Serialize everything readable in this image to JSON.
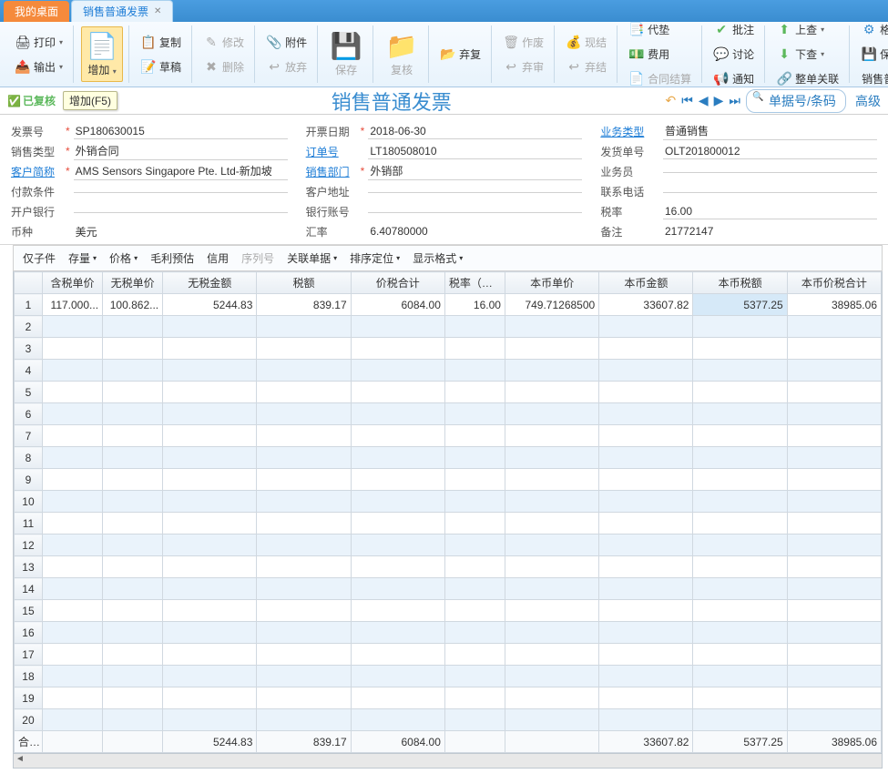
{
  "tabs": {
    "desktop": "我的桌面",
    "current": "销售普通发票"
  },
  "ribbon": {
    "print": "打印",
    "output": "输出",
    "add": "增加",
    "add_tip": "增加(F5)",
    "copy": "复制",
    "draft": "草稿",
    "modify": "修改",
    "delete": "删除",
    "attach": "附件",
    "discard": "放弃",
    "save": "保存",
    "recheck": "复核",
    "abandon": "弃复",
    "void": "作废",
    "abandon2": "弃审",
    "cash": "现结",
    "abandon3": "弃结",
    "advance": "代垫",
    "expense": "费用",
    "contract": "合同结算",
    "approve": "批注",
    "discuss": "讨论",
    "notify": "通知",
    "up": "上查",
    "down": "下查",
    "link": "整单关联",
    "format": "格式设置",
    "saveformat": "保存格式",
    "printtpl": "销售普通发票打印"
  },
  "status": {
    "reviewed": "已复核"
  },
  "title": "销售普通发票",
  "search": {
    "placeholder": "单据号/条码",
    "adv": "高级"
  },
  "form": {
    "l_invoice_no": "发票号",
    "invoice_no": "SP180630015",
    "l_invoice_date": "开票日期",
    "invoice_date": "2018-06-30",
    "l_biz_type": "业务类型",
    "biz_type": "普通销售",
    "l_sale_type": "销售类型",
    "sale_type": "外销合同",
    "l_order_no": "订单号",
    "order_no": "LT180508010",
    "l_ship_no": "发货单号",
    "ship_no": "OLT201800012",
    "l_customer": "客户简称",
    "customer": "AMS Sensors Singapore Pte. Ltd-新加坡",
    "l_sale_dept": "销售部门",
    "sale_dept": "外销部",
    "l_salesman": "业务员",
    "salesman": "",
    "l_pay_terms": "付款条件",
    "pay_terms": "",
    "l_cust_addr": "客户地址",
    "cust_addr": "",
    "l_phone": "联系电话",
    "phone": "",
    "l_bank": "开户银行",
    "bank": "",
    "l_bank_acct": "银行账号",
    "bank_acct": "",
    "l_tax_rate": "税率",
    "tax_rate": "16.00",
    "l_currency": "币种",
    "currency": "美元",
    "l_exch_rate": "汇率",
    "exch_rate": "6.40780000",
    "l_remark": "备注",
    "remark": "21772147"
  },
  "grid_toolbar": {
    "child": "仅子件",
    "stock": "存量",
    "price": "价格",
    "profit": "毛利预估",
    "credit": "信用",
    "serial": "序列号",
    "related": "关联单据",
    "sort": "排序定位",
    "display": "显示格式"
  },
  "columns": [
    "含税单价",
    "无税单价",
    "无税金额",
    "税额",
    "价税合计",
    "税率（%）",
    "本币单价",
    "本币金额",
    "本币税额",
    "本币价税合计"
  ],
  "row1": [
    "117.000...",
    "100.862...",
    "5244.83",
    "839.17",
    "6084.00",
    "16.00",
    "749.71268500",
    "33607.82",
    "5377.25",
    "38985.06"
  ],
  "total_label": "合计",
  "totals": [
    "",
    "",
    "5244.83",
    "839.17",
    "6084.00",
    "",
    "",
    "33607.82",
    "5377.25",
    "38985.06"
  ]
}
